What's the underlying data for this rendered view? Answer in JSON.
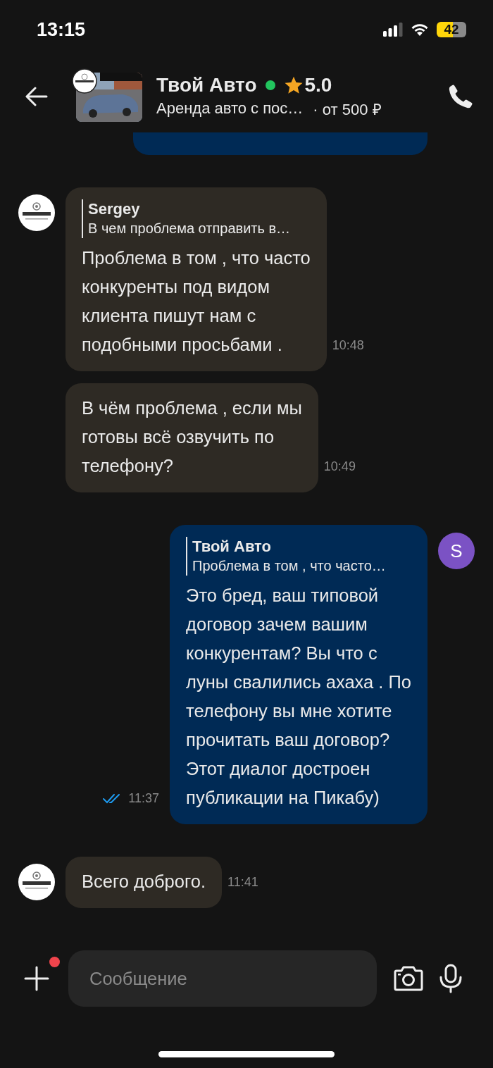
{
  "status_bar": {
    "time": "13:15",
    "battery": "42"
  },
  "header": {
    "title": "Твой Авто",
    "online": true,
    "rating": "5.0",
    "subtitle": "Аренда авто с пос…",
    "price": "· от 500 ₽"
  },
  "messages": [
    {
      "kind": "clipped",
      "outgoing": true
    },
    {
      "kind": "text",
      "outgoing": false,
      "reply": {
        "author": "Sergey",
        "text": "В чем проблема отправить в…"
      },
      "text": "Проблема в том , что часто\nконкуренты под видом\nклиента пишут нам с\nподобными просьбами .",
      "time": "10:48"
    },
    {
      "kind": "text",
      "outgoing": false,
      "text": "В чём проблема , если мы\nготовы всё озвучить по\nтелефону?",
      "time": "10:49"
    },
    {
      "kind": "text",
      "outgoing": true,
      "avatar": {
        "letter": "S",
        "color": "#7b52c4"
      },
      "read": true,
      "reply": {
        "author": "Твой Авто",
        "text": "Проблема в том , что часто…"
      },
      "text": "Это бред, ваш типовой\nдоговор зачем вашим\nконкурентам? Вы что с\nлуны свалились ахаха . По\nтелефону вы мне хотите\nпрочитать ваш договор?\nЭтот диалог достроен\nпубликации на Пикабу)",
      "time": "11:37"
    },
    {
      "kind": "text",
      "outgoing": false,
      "text": "Всего доброго.",
      "time": "11:41"
    }
  ],
  "composer": {
    "placeholder": "Сообщение",
    "attach_badge": true
  }
}
